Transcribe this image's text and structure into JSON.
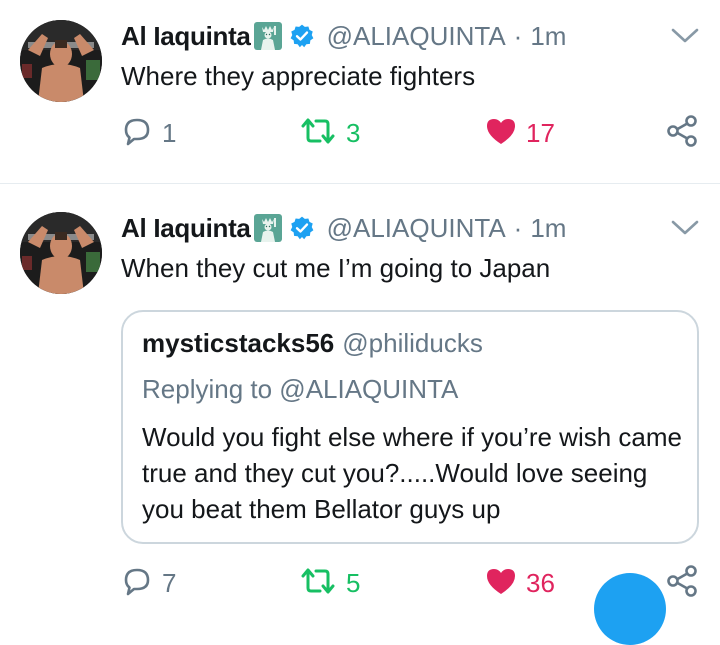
{
  "tweets": [
    {
      "display_name": "Al Iaquinta",
      "handle": "@ALIAQUINTA",
      "separator": "·",
      "time": "1m",
      "text": "Where they appreciate fighters",
      "reply_count": "1",
      "retweet_count": "3",
      "like_count": "17"
    },
    {
      "display_name": "Al Iaquinta",
      "handle": "@ALIAQUINTA",
      "separator": "·",
      "time": "1m",
      "text": "When they cut me I’m going to Japan",
      "quote": {
        "display_name": "mysticstacks56",
        "handle": "@philiducks",
        "replying_to": "Replying to @ALIAQUINTA",
        "text": "Would you fight else where if you’re wish came true and they cut you?.....Would love seeing you beat them Bellator guys up"
      },
      "reply_count": "7",
      "retweet_count": "5",
      "like_count": "36"
    }
  ],
  "icons": {
    "name_emoji": "statue-of-liberty-icon",
    "verified": "verified-badge-icon",
    "menu": "chevron-down-icon",
    "reply": "reply-icon",
    "retweet": "retweet-icon",
    "like": "heart-icon",
    "share": "share-icon",
    "compose": "compose-fab"
  },
  "colors": {
    "verified_blue": "#1da1f2",
    "retweet_green": "#17bf63",
    "like_red": "#e0245e",
    "secondary_gray": "#657786",
    "border_gray": "#ccd6dd"
  }
}
